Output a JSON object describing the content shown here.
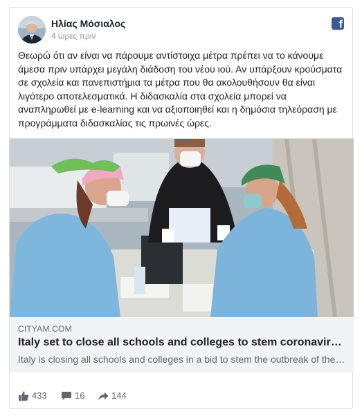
{
  "post": {
    "author": "Ηλίας Μόσιαλος",
    "time": "4 ώρες πριν",
    "text": "Θεωρώ ότι αν είναι να πάρουμε αντίστοιχα μέτρα πρέπει να το κάνουμε άμεσα πριν υπάρχει μεγάλη διάδοση του νέου ιού. Αν υπάρξουν κρούσματα σε σχολεία και πανεπιστήμια τα μέτρα που θα ακολουθήσουν θα είναι λιγότερο αποτελεσματικά. Η διδασκαλία στα σχολεία μπορεί να αναπληρωθεί με e-learning και να αξιοποιηθεί και η δημόσια τηλεόραση με προγράμματα διδασκαλίας τις πρωινές ώρες.",
    "platform_icon": "facebook-icon"
  },
  "link": {
    "domain": "CITYAM.COM",
    "title": "Italy set to close all schools and colleges to stem coronavirus outbreak",
    "description": "Italy is closing all schools and colleges in a bid to stem the outbreak of the coronavirus"
  },
  "stats": {
    "likes": "433",
    "comments": "16",
    "shares": "144"
  },
  "colors": {
    "facebook_blue": "#3b5998",
    "icon_grey": "#606770"
  }
}
